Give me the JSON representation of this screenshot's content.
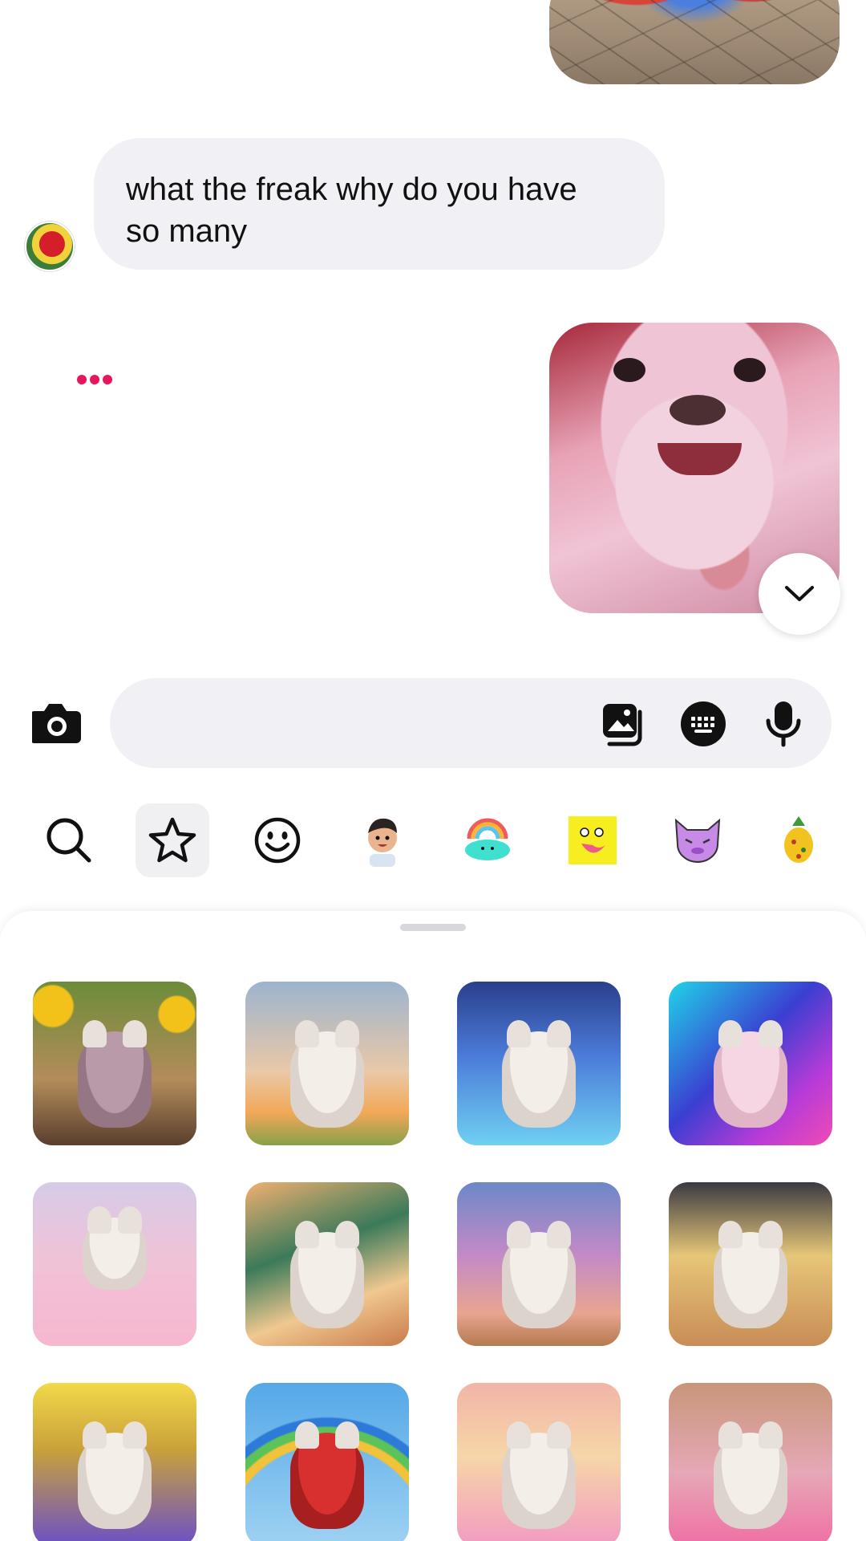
{
  "chat": {
    "received_message": {
      "line1": "what the freak why do you have",
      "line2": "so many"
    },
    "typing_indicator": "•••"
  },
  "composer": {
    "placeholder": "",
    "value": ""
  },
  "sticker_tabs": [
    {
      "icon": "search-icon",
      "active": false
    },
    {
      "icon": "star-icon",
      "active": true
    },
    {
      "icon": "smiley-icon",
      "active": false
    },
    {
      "icon": "avatar-boy-sticker",
      "active": false
    },
    {
      "icon": "rainbow-cloud-sticker",
      "active": false
    },
    {
      "icon": "yellow-face-sticker",
      "active": false
    },
    {
      "icon": "purple-cat-sticker",
      "active": false
    },
    {
      "icon": "pineapple-sticker",
      "active": false
    }
  ],
  "sticker_grid": [
    {
      "theme": "sunflowers"
    },
    {
      "theme": "sunset"
    },
    {
      "theme": "elsa-costume"
    },
    {
      "theme": "neon-party"
    },
    {
      "theme": "ballet-clouds"
    },
    {
      "theme": "dolphins-wave"
    },
    {
      "theme": "castle"
    },
    {
      "theme": "orca"
    },
    {
      "theme": "banana-crowd"
    },
    {
      "theme": "ladybug-rainbow"
    },
    {
      "theme": "candy-land"
    },
    {
      "theme": "bedroom"
    }
  ],
  "colors": {
    "typing_dot": "#e8175d",
    "bubble_bg": "#f1f1f5",
    "active_tab_bg": "#f0f0f3"
  }
}
